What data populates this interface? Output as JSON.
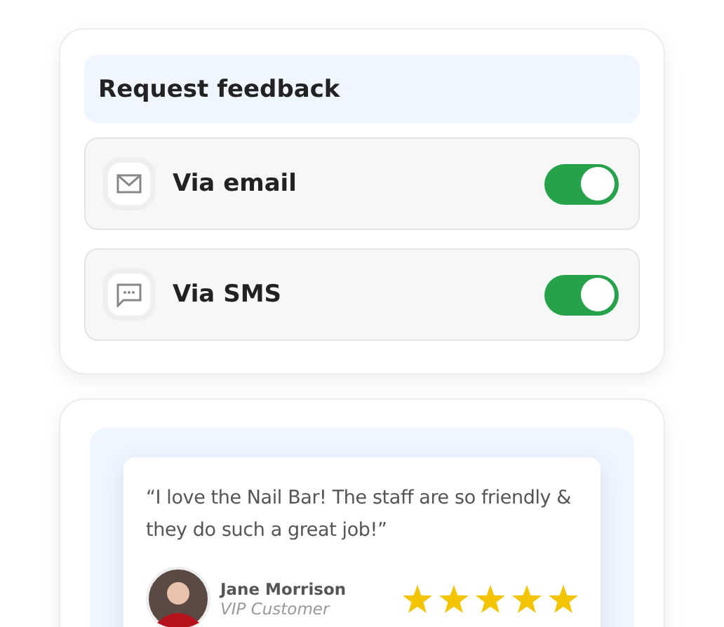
{
  "request_card": {
    "title": "Request feedback",
    "channels": [
      {
        "kind": "email",
        "label": "Via email",
        "on": true
      },
      {
        "kind": "sms",
        "label": "Via SMS",
        "on": true
      }
    ]
  },
  "review": {
    "quote": "“I love the Nail Bar! The staff are so friendly & they do such a great job!”",
    "name": "Jane Morrison",
    "role": "VIP Customer",
    "stars": 5
  }
}
